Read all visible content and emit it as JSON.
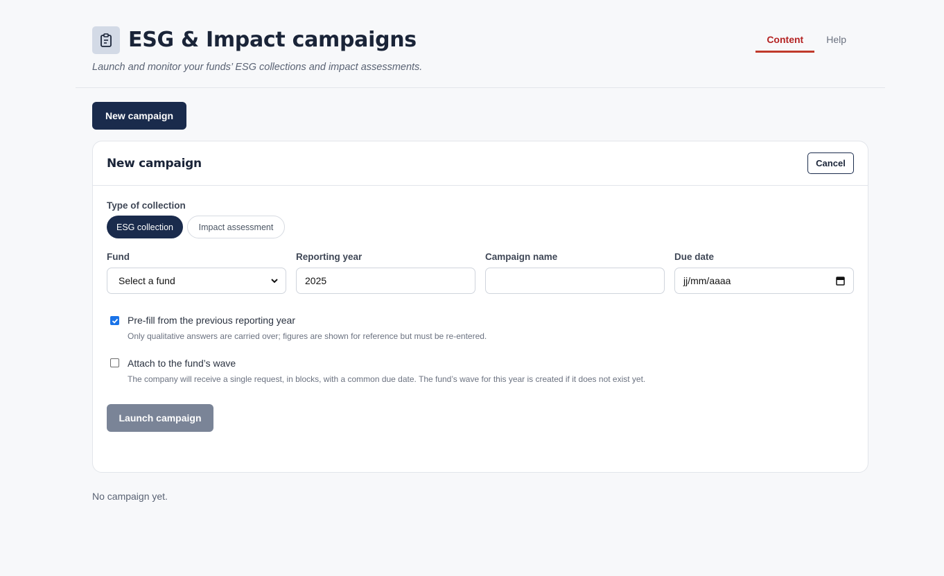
{
  "header": {
    "title": "ESG & Impact campaigns",
    "subtitle": "Launch and monitor your funds’ ESG collections and impact assessments.",
    "icon": "clipboard-icon",
    "tabs": [
      {
        "label": "Content",
        "active": true
      },
      {
        "label": "Help",
        "active": false
      }
    ],
    "accent_color": "#c0392b"
  },
  "actions": {
    "new_campaign_label": "New campaign"
  },
  "form": {
    "title": "New campaign",
    "cancel_label": "Cancel",
    "type_label": "Type of collection",
    "types": [
      {
        "label": "ESG collection",
        "selected": true
      },
      {
        "label": "Impact assessment",
        "selected": false
      }
    ],
    "fund": {
      "label": "Fund",
      "value": "Select a fund"
    },
    "reporting_year": {
      "label": "Reporting year",
      "value": "2025"
    },
    "campaign_name": {
      "label": "Campaign name",
      "value": ""
    },
    "due_date": {
      "label": "Due date",
      "placeholder": "jj/mm/aaaa"
    },
    "prefill": {
      "label": "Pre-fill from the previous reporting year",
      "hint": "Only qualitative answers are carried over; figures are shown for reference but must be re-entered.",
      "checked": true
    },
    "attach": {
      "label": "Attach to the fund’s wave",
      "hint": "The company will receive a single request, in blocks, with a common due date. The fund’s wave for this year is created if it does not exist yet.",
      "checked": false
    },
    "launch_label": "Launch campaign"
  },
  "empty_state": "No campaign yet.",
  "colors": {
    "primary": "#1a2b4c",
    "disabled": "#7a8497"
  }
}
